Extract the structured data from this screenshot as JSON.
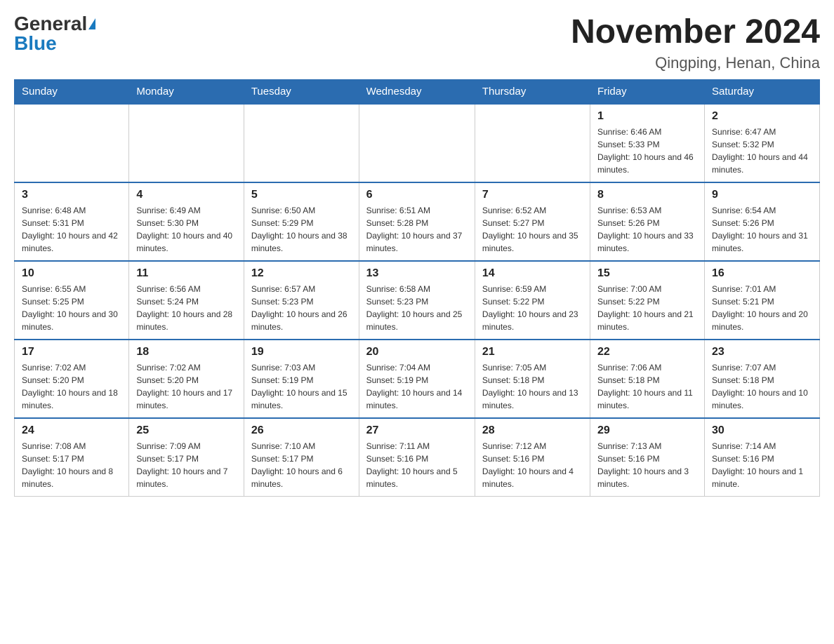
{
  "header": {
    "logo_general": "General",
    "logo_blue": "Blue",
    "month_title": "November 2024",
    "location": "Qingping, Henan, China"
  },
  "days_of_week": [
    "Sunday",
    "Monday",
    "Tuesday",
    "Wednesday",
    "Thursday",
    "Friday",
    "Saturday"
  ],
  "weeks": [
    [
      {
        "day": "",
        "info": ""
      },
      {
        "day": "",
        "info": ""
      },
      {
        "day": "",
        "info": ""
      },
      {
        "day": "",
        "info": ""
      },
      {
        "day": "",
        "info": ""
      },
      {
        "day": "1",
        "info": "Sunrise: 6:46 AM\nSunset: 5:33 PM\nDaylight: 10 hours and 46 minutes."
      },
      {
        "day": "2",
        "info": "Sunrise: 6:47 AM\nSunset: 5:32 PM\nDaylight: 10 hours and 44 minutes."
      }
    ],
    [
      {
        "day": "3",
        "info": "Sunrise: 6:48 AM\nSunset: 5:31 PM\nDaylight: 10 hours and 42 minutes."
      },
      {
        "day": "4",
        "info": "Sunrise: 6:49 AM\nSunset: 5:30 PM\nDaylight: 10 hours and 40 minutes."
      },
      {
        "day": "5",
        "info": "Sunrise: 6:50 AM\nSunset: 5:29 PM\nDaylight: 10 hours and 38 minutes."
      },
      {
        "day": "6",
        "info": "Sunrise: 6:51 AM\nSunset: 5:28 PM\nDaylight: 10 hours and 37 minutes."
      },
      {
        "day": "7",
        "info": "Sunrise: 6:52 AM\nSunset: 5:27 PM\nDaylight: 10 hours and 35 minutes."
      },
      {
        "day": "8",
        "info": "Sunrise: 6:53 AM\nSunset: 5:26 PM\nDaylight: 10 hours and 33 minutes."
      },
      {
        "day": "9",
        "info": "Sunrise: 6:54 AM\nSunset: 5:26 PM\nDaylight: 10 hours and 31 minutes."
      }
    ],
    [
      {
        "day": "10",
        "info": "Sunrise: 6:55 AM\nSunset: 5:25 PM\nDaylight: 10 hours and 30 minutes."
      },
      {
        "day": "11",
        "info": "Sunrise: 6:56 AM\nSunset: 5:24 PM\nDaylight: 10 hours and 28 minutes."
      },
      {
        "day": "12",
        "info": "Sunrise: 6:57 AM\nSunset: 5:23 PM\nDaylight: 10 hours and 26 minutes."
      },
      {
        "day": "13",
        "info": "Sunrise: 6:58 AM\nSunset: 5:23 PM\nDaylight: 10 hours and 25 minutes."
      },
      {
        "day": "14",
        "info": "Sunrise: 6:59 AM\nSunset: 5:22 PM\nDaylight: 10 hours and 23 minutes."
      },
      {
        "day": "15",
        "info": "Sunrise: 7:00 AM\nSunset: 5:22 PM\nDaylight: 10 hours and 21 minutes."
      },
      {
        "day": "16",
        "info": "Sunrise: 7:01 AM\nSunset: 5:21 PM\nDaylight: 10 hours and 20 minutes."
      }
    ],
    [
      {
        "day": "17",
        "info": "Sunrise: 7:02 AM\nSunset: 5:20 PM\nDaylight: 10 hours and 18 minutes."
      },
      {
        "day": "18",
        "info": "Sunrise: 7:02 AM\nSunset: 5:20 PM\nDaylight: 10 hours and 17 minutes."
      },
      {
        "day": "19",
        "info": "Sunrise: 7:03 AM\nSunset: 5:19 PM\nDaylight: 10 hours and 15 minutes."
      },
      {
        "day": "20",
        "info": "Sunrise: 7:04 AM\nSunset: 5:19 PM\nDaylight: 10 hours and 14 minutes."
      },
      {
        "day": "21",
        "info": "Sunrise: 7:05 AM\nSunset: 5:18 PM\nDaylight: 10 hours and 13 minutes."
      },
      {
        "day": "22",
        "info": "Sunrise: 7:06 AM\nSunset: 5:18 PM\nDaylight: 10 hours and 11 minutes."
      },
      {
        "day": "23",
        "info": "Sunrise: 7:07 AM\nSunset: 5:18 PM\nDaylight: 10 hours and 10 minutes."
      }
    ],
    [
      {
        "day": "24",
        "info": "Sunrise: 7:08 AM\nSunset: 5:17 PM\nDaylight: 10 hours and 8 minutes."
      },
      {
        "day": "25",
        "info": "Sunrise: 7:09 AM\nSunset: 5:17 PM\nDaylight: 10 hours and 7 minutes."
      },
      {
        "day": "26",
        "info": "Sunrise: 7:10 AM\nSunset: 5:17 PM\nDaylight: 10 hours and 6 minutes."
      },
      {
        "day": "27",
        "info": "Sunrise: 7:11 AM\nSunset: 5:16 PM\nDaylight: 10 hours and 5 minutes."
      },
      {
        "day": "28",
        "info": "Sunrise: 7:12 AM\nSunset: 5:16 PM\nDaylight: 10 hours and 4 minutes."
      },
      {
        "day": "29",
        "info": "Sunrise: 7:13 AM\nSunset: 5:16 PM\nDaylight: 10 hours and 3 minutes."
      },
      {
        "day": "30",
        "info": "Sunrise: 7:14 AM\nSunset: 5:16 PM\nDaylight: 10 hours and 1 minute."
      }
    ]
  ]
}
